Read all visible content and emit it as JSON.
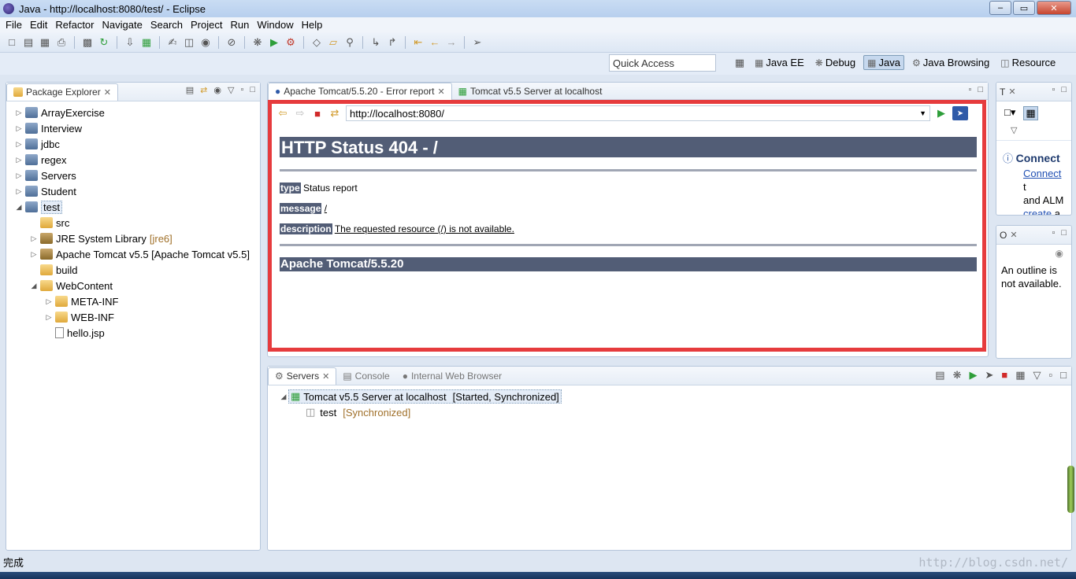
{
  "window": {
    "title": "Java - http://localhost:8080/test/ - Eclipse"
  },
  "menu": [
    "File",
    "Edit",
    "Refactor",
    "Navigate",
    "Search",
    "Project",
    "Run",
    "Window",
    "Help"
  ],
  "quick_access": {
    "placeholder": "Quick Access"
  },
  "perspectives": [
    {
      "label": "Java EE",
      "icon": "java-ee-icon",
      "active": false
    },
    {
      "label": "Debug",
      "icon": "debug-icon",
      "active": false
    },
    {
      "label": "Java",
      "icon": "java-icon",
      "active": true
    },
    {
      "label": "Java Browsing",
      "icon": "java-browsing-icon",
      "active": false
    },
    {
      "label": "Resource",
      "icon": "resource-icon",
      "active": false
    }
  ],
  "package_explorer": {
    "tab_label": "Package Explorer",
    "items": [
      {
        "label": "ArrayExercise",
        "depth": 0,
        "expand": "collapsed",
        "kind": "proj"
      },
      {
        "label": "Interview",
        "depth": 0,
        "expand": "collapsed",
        "kind": "proj"
      },
      {
        "label": "jdbc",
        "depth": 0,
        "expand": "collapsed",
        "kind": "proj"
      },
      {
        "label": "regex",
        "depth": 0,
        "expand": "collapsed",
        "kind": "proj"
      },
      {
        "label": "Servers",
        "depth": 0,
        "expand": "collapsed",
        "kind": "proj"
      },
      {
        "label": "Student",
        "depth": 0,
        "expand": "collapsed",
        "kind": "proj"
      },
      {
        "label": "test",
        "depth": 0,
        "expand": "expanded",
        "kind": "proj",
        "selected": true
      },
      {
        "label": "src",
        "depth": 1,
        "expand": "none",
        "kind": "folder"
      },
      {
        "label": "JRE System Library",
        "suffix": "[jre6]",
        "depth": 1,
        "expand": "collapsed",
        "kind": "lib"
      },
      {
        "label": "Apache Tomcat v5.5 [Apache Tomcat v5.5]",
        "depth": 1,
        "expand": "collapsed",
        "kind": "lib"
      },
      {
        "label": "build",
        "depth": 1,
        "expand": "none",
        "kind": "folder"
      },
      {
        "label": "WebContent",
        "depth": 1,
        "expand": "expanded",
        "kind": "folder"
      },
      {
        "label": "META-INF",
        "depth": 2,
        "expand": "collapsed",
        "kind": "folder"
      },
      {
        "label": "WEB-INF",
        "depth": 2,
        "expand": "collapsed",
        "kind": "folder"
      },
      {
        "label": "hello.jsp",
        "depth": 2,
        "expand": "none",
        "kind": "file"
      }
    ]
  },
  "editor": {
    "tabs": [
      {
        "label": "Apache Tomcat/5.5.20 - Error report",
        "active": true
      },
      {
        "label": "Tomcat v5.5 Server at localhost",
        "active": false
      }
    ],
    "url": "http://localhost:8080/",
    "page": {
      "heading": "HTTP Status 404 - /",
      "type_label": "type",
      "type_value": "Status report",
      "message_label": "message",
      "message_value": "/",
      "description_label": "description",
      "description_value": "The requested resource (/) is not available.",
      "footer": "Apache Tomcat/5.5.20"
    }
  },
  "right_top": {
    "tab_label": "T",
    "connect_title": "Connect",
    "connect_link": "Connect",
    "line2_a": "t",
    "line2_b": "and ALM",
    "create_link": "create",
    "line3_b": "a l"
  },
  "right_bottom": {
    "tab_label": "O",
    "message": "An outline is not available."
  },
  "servers_panel": {
    "tabs": [
      {
        "label": "Servers",
        "active": true
      },
      {
        "label": "Console",
        "active": false
      },
      {
        "label": "Internal Web Browser",
        "active": false
      }
    ],
    "server": {
      "label": "Tomcat v5.5 Server at localhost",
      "state": "[Started, Synchronized]"
    },
    "module": {
      "label": "test",
      "state": "[Synchronized]"
    }
  },
  "status": {
    "text": "完成"
  },
  "watermark": "http://blog.csdn.net/"
}
